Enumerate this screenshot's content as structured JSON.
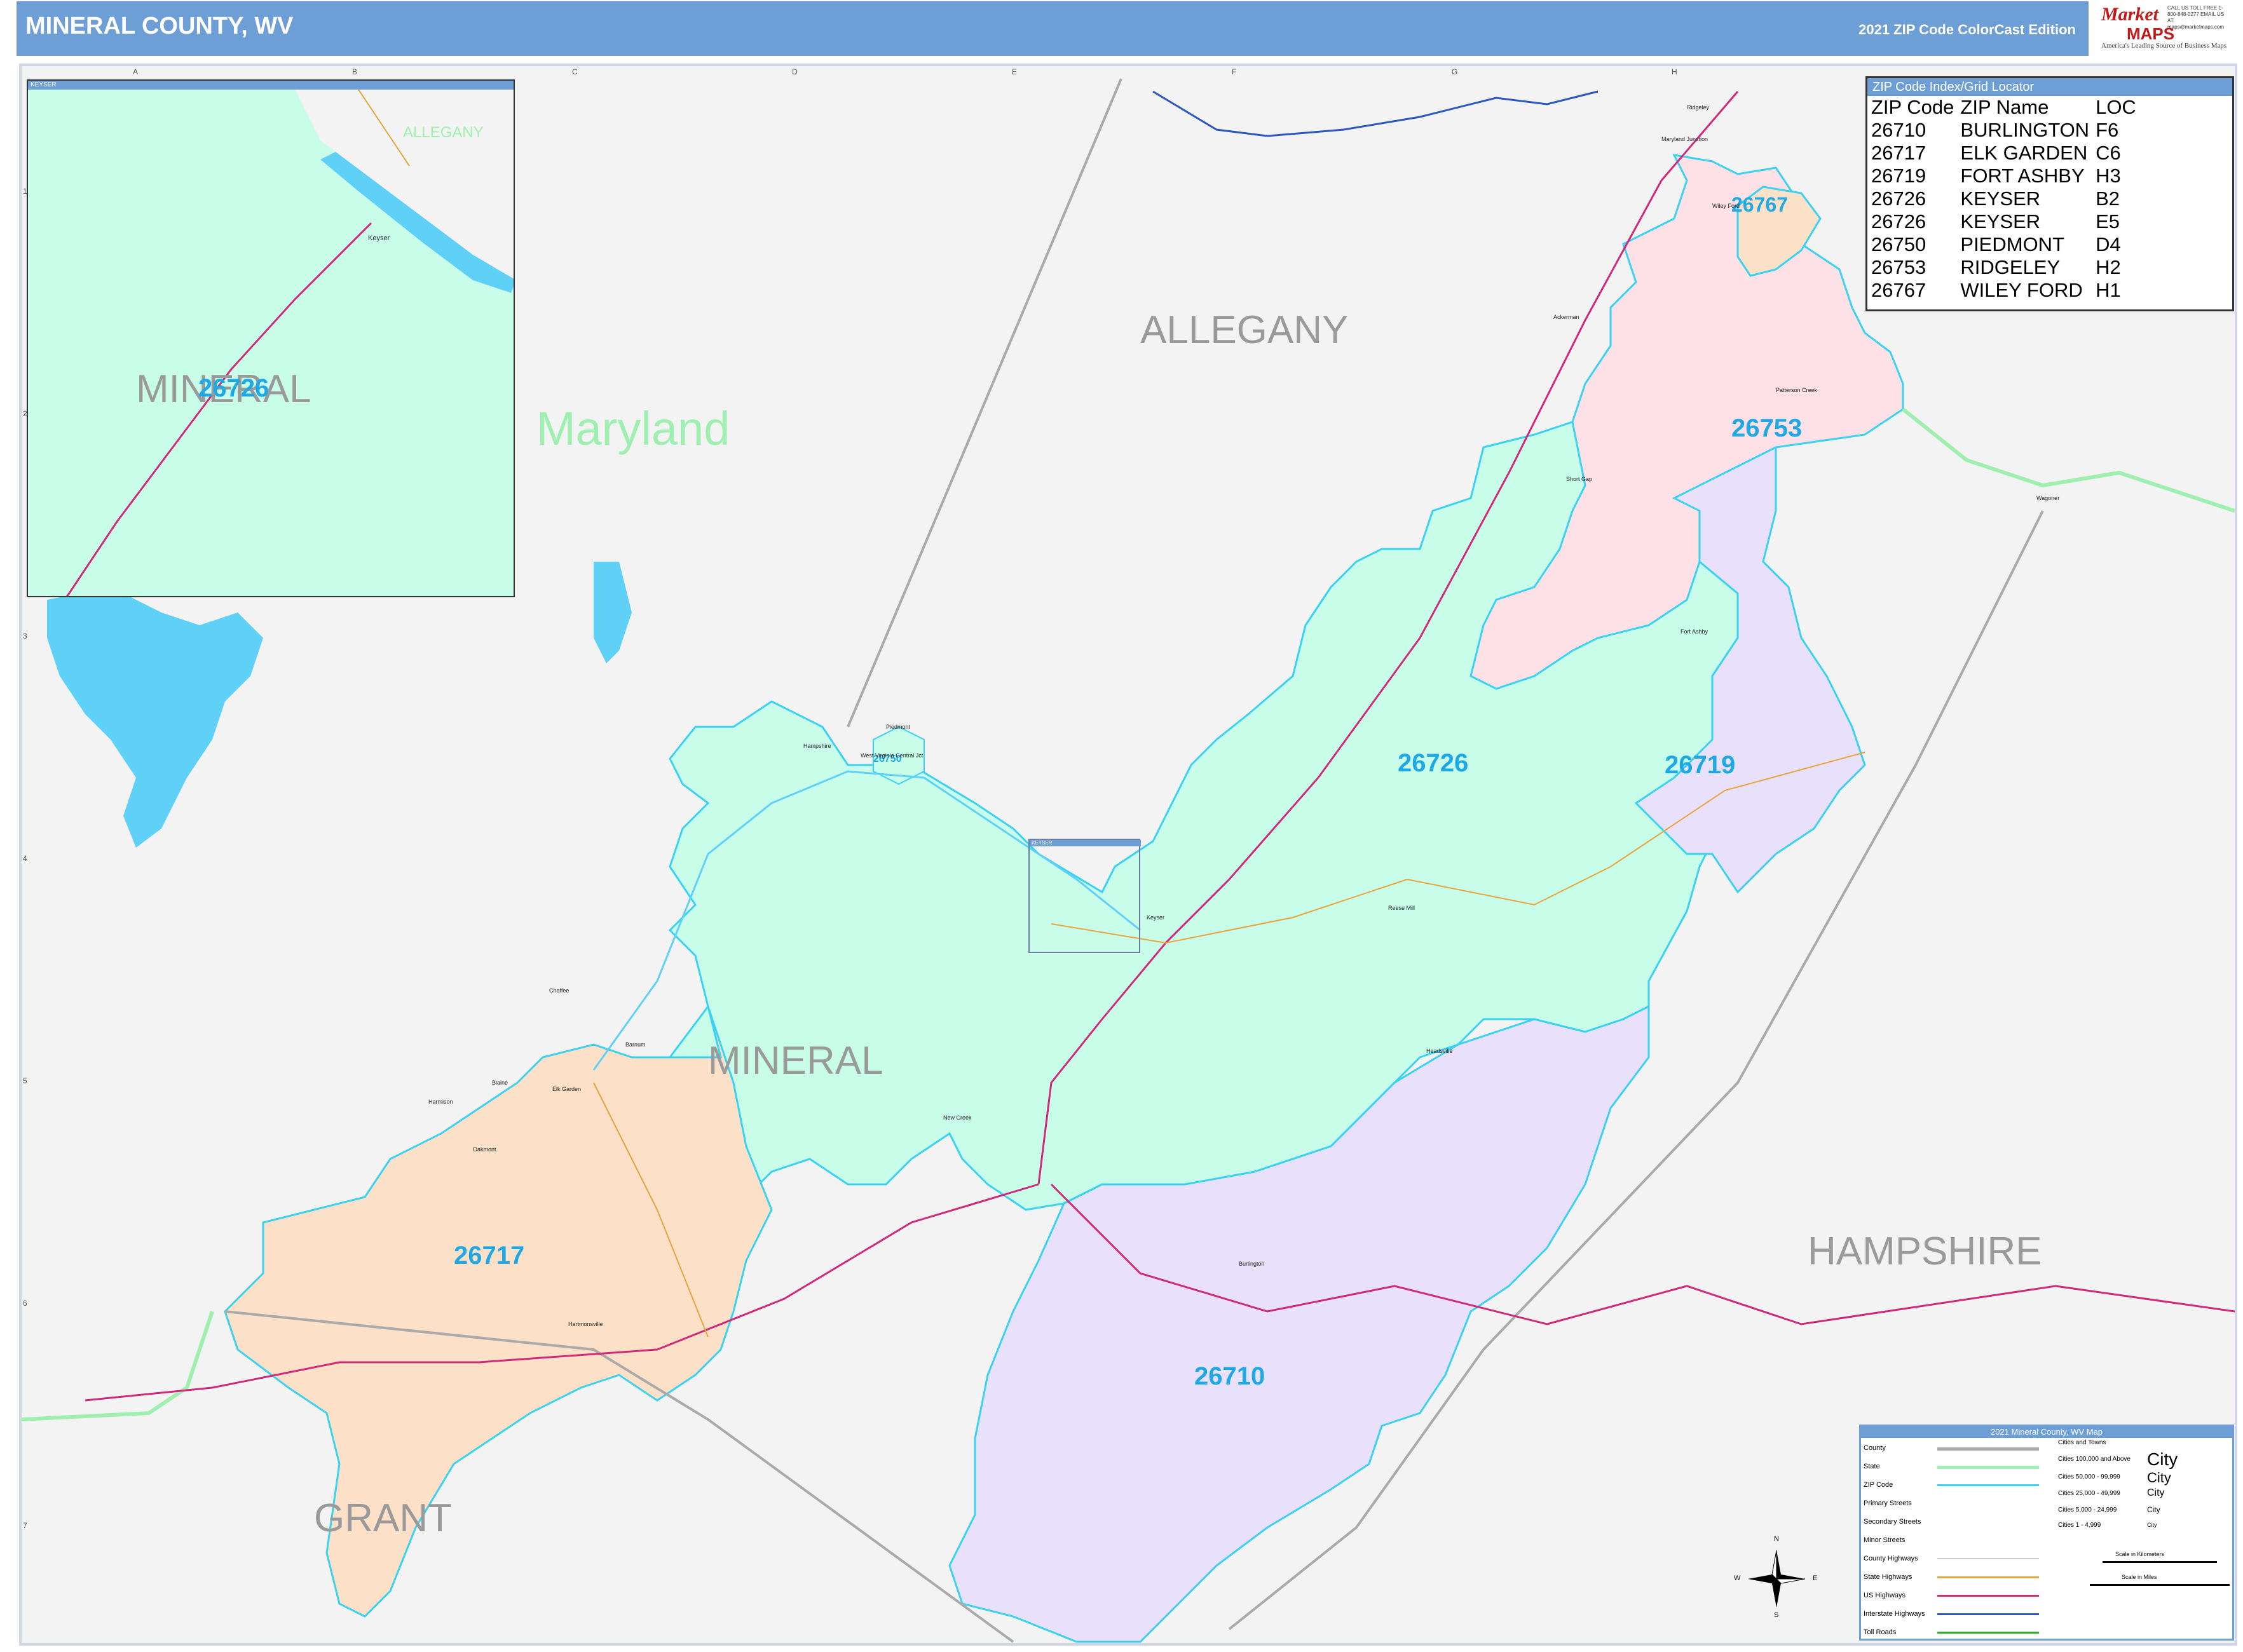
{
  "header": {
    "title": "MINERAL COUNTY, WV",
    "edition": "2021 ZIP Code ColorCast Edition",
    "logo_line1": "Market",
    "logo_line2": "MAPS",
    "logo_tagline": "America's Leading Source of Business Maps",
    "logo_contact": "CALL US TOLL FREE 1-800-848-0277 EMAIL US AT: maps@marketmaps.com",
    "header_color": "#6e9ed6"
  },
  "grid": {
    "columns": [
      "A",
      "B",
      "C",
      "D",
      "E",
      "F",
      "G",
      "H"
    ],
    "rows": [
      "1",
      "2",
      "3",
      "4",
      "5",
      "6",
      "7"
    ]
  },
  "regions": {
    "state_maryland": "Maryland",
    "county_allegany": "ALLEGANY",
    "county_mineral": "MINERAL",
    "county_hampshire": "HAMPSHIRE",
    "county_grant": "GRANT"
  },
  "zip_areas": [
    {
      "zip": "26726",
      "color": "#c8fde9"
    },
    {
      "zip": "26719",
      "color": "#e9e1fb"
    },
    {
      "zip": "26753",
      "color": "#fde1e6"
    },
    {
      "zip": "26767",
      "color": "#fbe1c7"
    },
    {
      "zip": "26717",
      "color": "#fde0c8"
    },
    {
      "zip": "26710",
      "color": "#e9e1fb"
    },
    {
      "zip": "26750",
      "color": "#c8fde9"
    }
  ],
  "towns": [
    "Wiley Ford",
    "Maryland Junction",
    "Ridgeley",
    "Ackerman",
    "Patterson Creek",
    "Short Gap",
    "Fort Ashby",
    "Hampshire",
    "West Virginia Central Jct",
    "Piedmont",
    "Keyser",
    "Reese Mill",
    "Headsville",
    "New Creek",
    "Burlington",
    "Elk Garden",
    "Harmison",
    "Oakmont",
    "Chaffee",
    "Blaine",
    "Hartmonsville",
    "Wagoner",
    "Barnum"
  ],
  "zip_index": {
    "title": "ZIP Code Index/Grid Locator",
    "headers": [
      "ZIP Code",
      "ZIP Name",
      "LOC"
    ],
    "rows": [
      [
        "26710",
        "BURLINGTON",
        "F6"
      ],
      [
        "26717",
        "ELK GARDEN",
        "C6"
      ],
      [
        "26719",
        "FORT ASHBY",
        "H3"
      ],
      [
        "26726",
        "KEYSER",
        "B2"
      ],
      [
        "26726",
        "KEYSER",
        "E5"
      ],
      [
        "26750",
        "PIEDMONT",
        "D4"
      ],
      [
        "26753",
        "RIDGELEY",
        "H2"
      ],
      [
        "26767",
        "WILEY FORD",
        "H1"
      ]
    ]
  },
  "inset": {
    "title": "KEYSER",
    "label_county": "MINERAL",
    "label_zip": "26726",
    "label_allegany": "ALLEGANY",
    "town": "Keyser"
  },
  "legend": {
    "title": "2021 Mineral County, WV Map",
    "items": [
      "County",
      "State",
      "ZIP Code",
      "Primary Streets",
      "Secondary Streets",
      "Minor Streets",
      "County Highways",
      "State Highways",
      "US Highways",
      "Interstate Highways",
      "Toll Roads"
    ],
    "cities_header": "Cities and Towns",
    "city_ranges": [
      "Cities 100,000 and Above",
      "Cities 50,000 - 99,999",
      "Cities 25,000 - 49,999",
      "Cities 5,000 - 24,999",
      "Cities 1 - 4,999"
    ],
    "city_samples": [
      "City",
      "City",
      "City",
      "City",
      "City"
    ],
    "scale_km": "Scale in Kilometers",
    "scale_mi": "Scale in Miles",
    "colors": {
      "county": "#aaaaaa",
      "state": "#9ff0b0",
      "zip": "#39d2f0",
      "state_highway": "#e8a33a",
      "us_highway": "#d0297a",
      "interstate": "#2a57c0",
      "toll": "#2aaa2a"
    }
  },
  "compass": {
    "n": "N",
    "s": "S",
    "e": "E",
    "w": "W"
  }
}
